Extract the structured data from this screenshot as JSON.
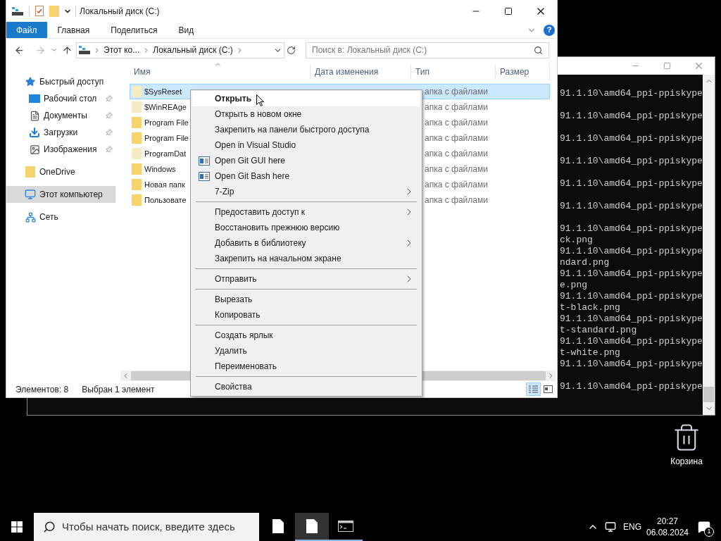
{
  "console": {
    "lines": [
      {
        "kind": "fragment",
        "text": "91.1.10\\amd64_ppi-ppiskype"
      },
      {
        "kind": "blank"
      },
      {
        "kind": "fragment",
        "text": "91.1.10\\amd64_ppi-ppiskype"
      },
      {
        "kind": "blank"
      },
      {
        "kind": "fragment",
        "text": "91.1.10\\amd64_ppi-ppiskype"
      },
      {
        "kind": "blank"
      },
      {
        "kind": "fragment",
        "text": "91.1.10\\amd64_ppi-ppiskype"
      },
      {
        "kind": "blank"
      },
      {
        "kind": "fragment",
        "text": "91.1.10\\amd64_ppi-ppiskype"
      },
      {
        "kind": "blank"
      },
      {
        "kind": "fragment",
        "text": "91.1.10\\amd64_ppi-ppiskype"
      },
      {
        "kind": "blank"
      },
      {
        "kind": "fragment",
        "text": "91.1.10\\amd64_ppi-ppiskype"
      },
      {
        "kind": "fragment",
        "text": "ck.png"
      },
      {
        "kind": "fragment",
        "text": "91.1.10\\amd64_ppi-ppiskype"
      },
      {
        "kind": "fragment",
        "text": "ndard.png"
      },
      {
        "kind": "fragment",
        "text": "91.1.10\\amd64_ppi-ppiskype"
      },
      {
        "kind": "fragment",
        "text": "e.png"
      },
      {
        "kind": "fragment",
        "text": "91.1.10\\amd64_ppi-ppiskype"
      },
      {
        "kind": "fragment",
        "text": "t-black.png"
      },
      {
        "kind": "fragment",
        "text": "91.1.10\\amd64_ppi-ppiskype"
      },
      {
        "kind": "fragment",
        "text": "t-standard.png"
      },
      {
        "kind": "fragment",
        "text": "91.1.10\\amd64_ppi-ppiskype"
      },
      {
        "kind": "fragment",
        "text": "t-white.png"
      },
      {
        "kind": "fragment",
        "text": "91.1.10\\amd64_ppi-ppiskype"
      },
      {
        "kind": "blank"
      },
      {
        "kind": "fragment",
        "text": "91.1.10\\amd64_ppi-ppiskype"
      }
    ]
  },
  "explorer": {
    "title": "Локальный диск (C:)",
    "ribbon_tabs": [
      {
        "label": "Файл",
        "kind": "file"
      },
      {
        "label": "Главная",
        "kind": "tab"
      },
      {
        "label": "Поделиться",
        "kind": "tab"
      },
      {
        "label": "Вид",
        "kind": "tab"
      }
    ],
    "help": "?",
    "address": {
      "crumbs": [
        "Этот ко...",
        "Локальный диск (C:)"
      ]
    },
    "search": {
      "placeholder": "Поиск в: Локальный диск (C:)"
    },
    "nav": [
      {
        "label": "Быстрый доступ",
        "kind": "quick_access",
        "selected": false,
        "children": [
          {
            "label": "Рабочий стол",
            "kind": "desktop",
            "pinned": true,
            "selected": false
          },
          {
            "label": "Документы",
            "kind": "documents",
            "pinned": true,
            "selected": false
          },
          {
            "label": "Загрузки",
            "kind": "downloads",
            "pinned": true,
            "selected": false
          },
          {
            "label": "Изображения",
            "kind": "pictures",
            "pinned": true,
            "selected": false
          }
        ]
      },
      {
        "label": "OneDrive",
        "kind": "folder",
        "selected": false
      },
      {
        "label": "Этот компьютер",
        "kind": "computer",
        "selected": true
      },
      {
        "label": "Сеть",
        "kind": "network",
        "selected": false
      }
    ],
    "columns": [
      "Имя",
      "Дата изменения",
      "Тип",
      "Размер"
    ],
    "files": [
      {
        "name": "$SysReset",
        "type": "апка с файлами",
        "hidden": true,
        "selected": true
      },
      {
        "name": "$WinREAge",
        "type": "апка с файлами",
        "hidden": true,
        "selected": false
      },
      {
        "name": "Program File",
        "type": "апка с файлами",
        "hidden": false,
        "selected": false
      },
      {
        "name": "Program File",
        "type": "апка с файлами",
        "hidden": false,
        "selected": false
      },
      {
        "name": "ProgramDat",
        "type": "апка с файлами",
        "hidden": true,
        "selected": false
      },
      {
        "name": "Windows",
        "type": "апка с файлами",
        "hidden": false,
        "selected": false
      },
      {
        "name": "Новая папк",
        "type": "апка с файлами",
        "hidden": false,
        "selected": false
      },
      {
        "name": "Пользовате",
        "type": "апка с файлами",
        "hidden": false,
        "selected": false
      }
    ],
    "status": {
      "count": "Элементов: 8",
      "selection": "Выбран 1 элемент",
      "views": [
        {
          "kind": "details",
          "selected": true
        },
        {
          "kind": "tiles",
          "selected": false
        }
      ]
    }
  },
  "context_menu": {
    "items": [
      {
        "kind": "item",
        "label": "Открыть",
        "bold": true,
        "submenu": false,
        "selected": true
      },
      {
        "kind": "item",
        "label": "Открыть в новом окне",
        "submenu": false,
        "selected": false
      },
      {
        "kind": "item",
        "label": "Закрепить на панели быстрого доступа",
        "submenu": false,
        "selected": false
      },
      {
        "kind": "item",
        "label": "Open in Visual Studio",
        "submenu": false,
        "selected": false
      },
      {
        "kind": "icon_item",
        "label": "Open Git GUI here",
        "submenu": false,
        "selected": false
      },
      {
        "kind": "icon_item",
        "label": "Open Git Bash here",
        "submenu": false,
        "selected": false
      },
      {
        "kind": "item",
        "label": "7-Zip",
        "submenu": true,
        "selected": false
      },
      {
        "kind": "separator"
      },
      {
        "kind": "item",
        "label": "Предоставить доступ к",
        "submenu": true,
        "selected": false
      },
      {
        "kind": "item",
        "label": "Восстановить прежнюю версию",
        "submenu": false,
        "selected": false
      },
      {
        "kind": "item",
        "label": "Добавить в библиотеку",
        "submenu": true,
        "selected": false
      },
      {
        "kind": "item",
        "label": "Закрепить на начальном экране",
        "submenu": false,
        "selected": false
      },
      {
        "kind": "separator"
      },
      {
        "kind": "item",
        "label": "Отправить",
        "submenu": true,
        "selected": false
      },
      {
        "kind": "separator"
      },
      {
        "kind": "item",
        "label": "Вырезать",
        "submenu": false,
        "selected": false
      },
      {
        "kind": "item",
        "label": "Копировать",
        "submenu": false,
        "selected": false
      },
      {
        "kind": "separator"
      },
      {
        "kind": "item",
        "label": "Создать ярлык",
        "submenu": false,
        "selected": false
      },
      {
        "kind": "item",
        "label": "Удалить",
        "submenu": false,
        "selected": false
      },
      {
        "kind": "item",
        "label": "Переименовать",
        "submenu": false,
        "selected": false
      },
      {
        "kind": "separator"
      },
      {
        "kind": "item",
        "label": "Свойства",
        "submenu": false,
        "selected": false
      }
    ]
  },
  "desktop": {
    "recycle_bin": {
      "label": "Корзина"
    }
  },
  "taskbar": {
    "search_placeholder": "Чтобы начать поиск, введите здесь",
    "apps": [
      {
        "kind": "file",
        "running": false,
        "selected": false
      },
      {
        "kind": "file",
        "running": true,
        "selected": true
      },
      {
        "kind": "console",
        "running": true,
        "selected": false
      }
    ],
    "language": "ENG",
    "time": "20:27",
    "date": "06.08.2024",
    "notifications": "1"
  }
}
